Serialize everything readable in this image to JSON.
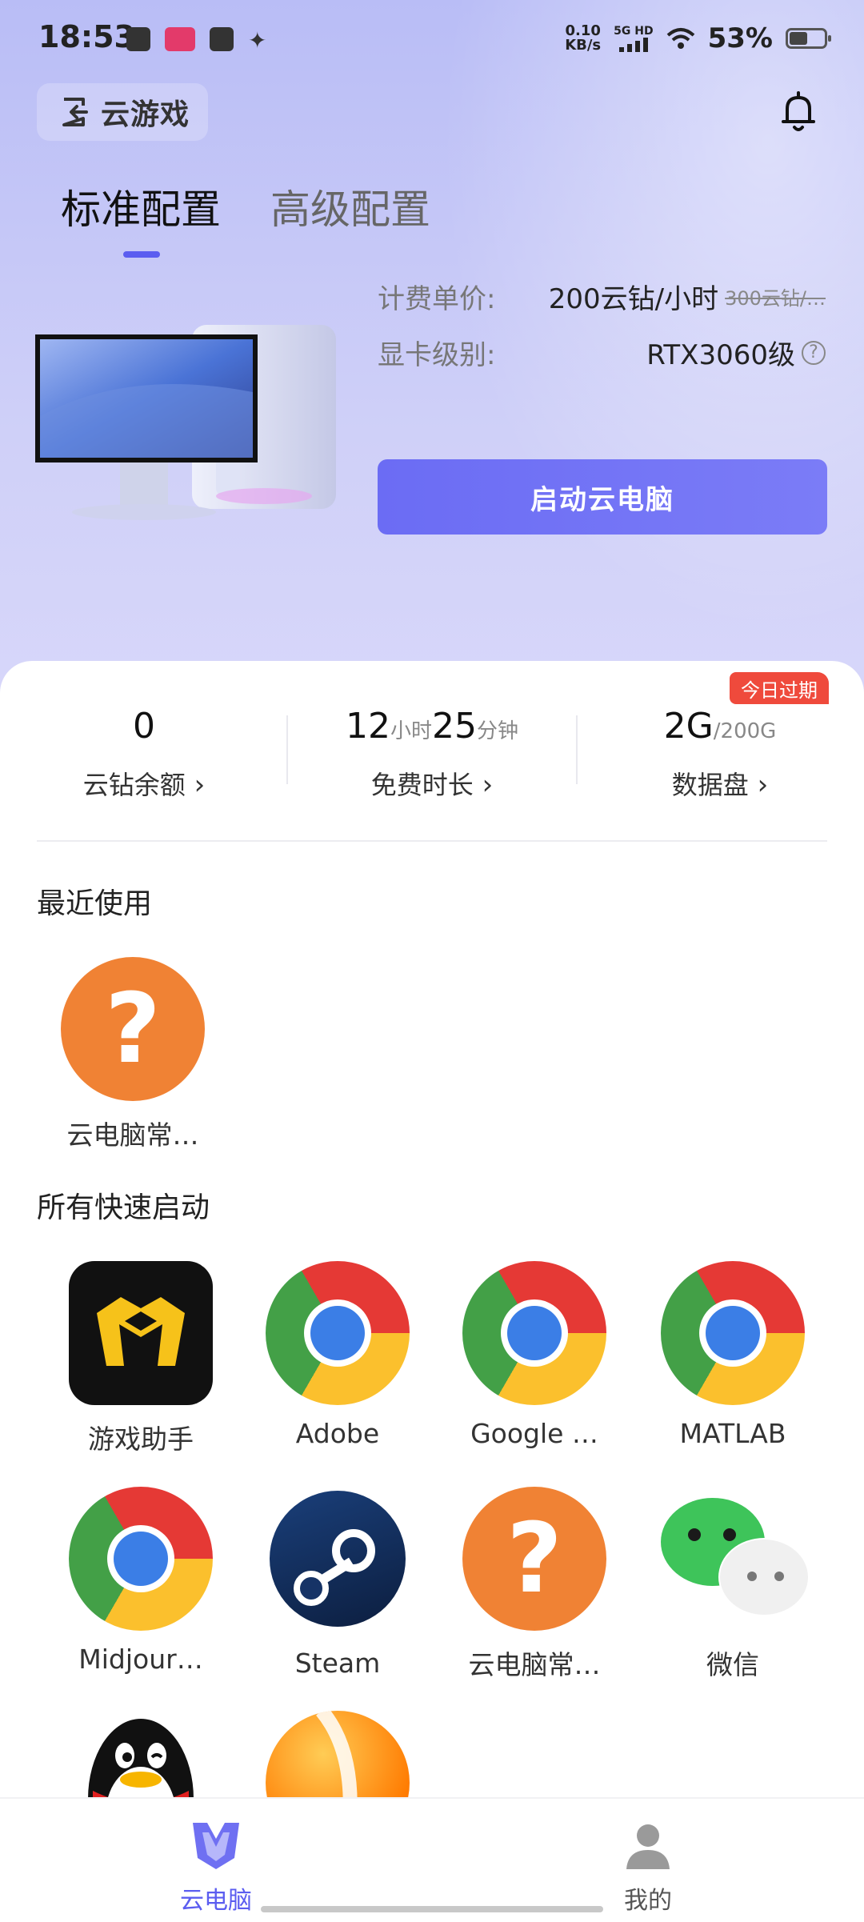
{
  "status_bar": {
    "time": "18:53",
    "net_speed_value": "0.10",
    "net_speed_unit": "KB/s",
    "network": "5G HD",
    "battery": "53%"
  },
  "header": {
    "back_label": "云游戏",
    "notification_icon": "bell-icon"
  },
  "tabs": [
    {
      "label": "标准配置",
      "active": true
    },
    {
      "label": "高级配置",
      "active": false
    }
  ],
  "config": {
    "price_key": "计费单价:",
    "price_value": "200云钻/小时",
    "price_original": "300云钻/…",
    "gpu_key": "显卡级别:",
    "gpu_value": "RTX3060级",
    "start_button": "启动云电脑"
  },
  "stats": {
    "expire_badge": "今日过期",
    "balance_value": "0",
    "balance_label": "云钻余额",
    "free_hours": "12",
    "hours_unit": "小时",
    "free_minutes": "25",
    "minutes_unit": "分钟",
    "free_label": "免费时长",
    "disk_used": "2G",
    "disk_total": "/200G",
    "disk_label": "数据盘"
  },
  "recent": {
    "title": "最近使用",
    "items": [
      {
        "name": "云电脑常…",
        "icon": "help-icon"
      }
    ]
  },
  "quick_launch": {
    "title": "所有快速启动",
    "items": [
      {
        "name": "游戏助手",
        "icon": "game-helper-icon"
      },
      {
        "name": "Adobe",
        "icon": "chrome-icon"
      },
      {
        "name": "Google …",
        "icon": "chrome-icon"
      },
      {
        "name": "MATLAB",
        "icon": "chrome-icon"
      },
      {
        "name": "Midjour…",
        "icon": "chrome-icon"
      },
      {
        "name": "Steam",
        "icon": "steam-icon"
      },
      {
        "name": "云电脑常…",
        "icon": "help-icon"
      },
      {
        "name": "微信",
        "icon": "wechat-icon"
      },
      {
        "name": "",
        "icon": "qq-icon"
      },
      {
        "name": "",
        "icon": "orange-app-icon"
      }
    ]
  },
  "bottom_nav": [
    {
      "label": "云电脑",
      "active": true,
      "color": "#5b5df0"
    },
    {
      "label": "我的",
      "active": false,
      "color": "#555555"
    }
  ]
}
